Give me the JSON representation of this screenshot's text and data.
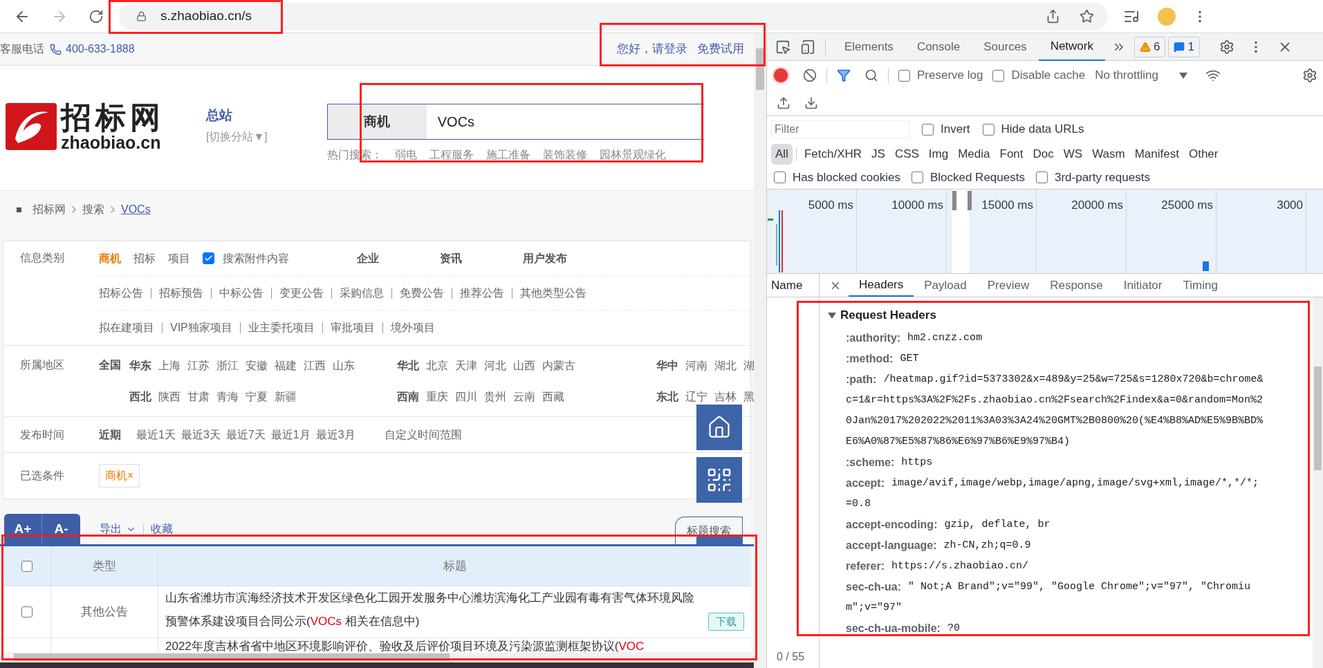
{
  "browser": {
    "url": "s.zhaobiao.cn/s"
  },
  "page": {
    "topbar": {
      "phone_label": "客服电话",
      "phone": "400-633-1888",
      "links": [
        "您好，请登录",
        "免费试用"
      ]
    },
    "logo": {
      "name": "招标网",
      "domain": "zhaobiao.cn"
    },
    "station": {
      "name": "总站",
      "switch": "[切换分站▼]"
    },
    "search": {
      "category": "商机",
      "value": "VOCs",
      "hot_label": "热门搜索：",
      "hot": [
        "弱电",
        "工程服务",
        "施工准备",
        "装饰装修",
        "园林景观绿化"
      ]
    },
    "breadcrumb": [
      "招标网",
      "搜索",
      "VOCs"
    ],
    "filters": [
      {
        "label": "信息类别",
        "kind": "category",
        "lines": [
          {
            "divided": false,
            "items": [
              {
                "kind": "option",
                "text": "商机",
                "selected": true
              },
              {
                "kind": "option",
                "text": "招标",
                "selected": false
              },
              {
                "kind": "option",
                "text": "项目",
                "selected": false
              },
              {
                "kind": "checkbox",
                "text": "搜索附件内容",
                "checked": true
              },
              {
                "kind": "heading",
                "text": "企业"
              },
              {
                "kind": "heading",
                "text": "资讯"
              },
              {
                "kind": "heading",
                "text": "用户发布"
              }
            ]
          },
          {
            "divided": true,
            "items": [
              {
                "kind": "option",
                "text": "招标公告",
                "selected": false
              },
              {
                "kind": "option",
                "text": "招标预告",
                "selected": false
              },
              {
                "kind": "option",
                "text": "中标公告",
                "selected": false
              },
              {
                "kind": "option",
                "text": "变更公告",
                "selected": false
              },
              {
                "kind": "option",
                "text": "采购信息",
                "selected": false
              },
              {
                "kind": "option",
                "text": "免费公告",
                "selected": false
              },
              {
                "kind": "option",
                "text": "推荐公告",
                "selected": false
              },
              {
                "kind": "option",
                "text": "其他类型公告",
                "selected": false
              }
            ]
          },
          {
            "divided": true,
            "items": [
              {
                "kind": "option",
                "text": "拟在建项目",
                "selected": false
              },
              {
                "kind": "option",
                "text": "VIP独家项目",
                "selected": false
              },
              {
                "kind": "option",
                "text": "业主委托项目",
                "selected": false
              },
              {
                "kind": "option",
                "text": "审批项目",
                "selected": false
              },
              {
                "kind": "option",
                "text": "境外项目",
                "selected": false
              }
            ]
          }
        ]
      },
      {
        "label": "所属地区",
        "kind": "region",
        "lead": "全国",
        "lines": [
          [
            {
              "region": "华东",
              "areas": [
                "上海",
                "江苏",
                "浙江",
                "安徽",
                "福建",
                "江西",
                "山东"
              ]
            },
            {
              "region": "华北",
              "areas": [
                "北京",
                "天津",
                "河北",
                "山西",
                "内蒙古"
              ]
            },
            {
              "region": "华中",
              "areas": [
                "河南",
                "湖北",
                "湖"
              ]
            }
          ],
          [
            {
              "region": "西北",
              "areas": [
                "陕西",
                "甘肃",
                "青海",
                "宁夏",
                "新疆"
              ]
            },
            {
              "region": "西南",
              "areas": [
                "重庆",
                "四川",
                "贵州",
                "云南",
                "西藏"
              ]
            },
            {
              "region": "东北",
              "areas": [
                "辽宁",
                "吉林",
                "黑"
              ]
            }
          ]
        ]
      },
      {
        "label": "发布时间",
        "kind": "time",
        "lead": "近期",
        "options": [
          "最近1天",
          "最近3天",
          "最近7天",
          "最近1月",
          "最近3月"
        ],
        "custom": "自定义时间范围"
      },
      {
        "label": "已选条件",
        "kind": "chosen",
        "tags": [
          {
            "text": "商机",
            "remove": "×"
          }
        ]
      }
    ],
    "toolbar": {
      "font_buttons": [
        "A+",
        "A-"
      ],
      "export": "导出",
      "favorite": "收藏",
      "title_search": "标题搜索"
    },
    "table": {
      "header_checked": false,
      "columns": [
        "类型",
        "标题"
      ],
      "rows": [
        {
          "checked": false,
          "type": "其他公告",
          "title": {
            "before": "山东省潍坊市滨海经济技术开发区绿色化工园开发服务中心潍坊滨海化工产业园有毒有害气体环境风险预警体系建设项目合同公示(",
            "highlight": "VOCs",
            "after": " 相关在信息中)"
          },
          "download": "下载"
        },
        {
          "title": {
            "before": "2022年度吉林省省中地区环境影响评价、验收及后评价项目环境及污染源监测框架协议(",
            "highlight": "VOC"
          }
        }
      ]
    }
  },
  "devtools": {
    "tabs": [
      {
        "label": "Elements",
        "selected": false
      },
      {
        "label": "Console",
        "selected": false
      },
      {
        "label": "Sources",
        "selected": false
      },
      {
        "label": "Network",
        "selected": true
      }
    ],
    "warnings": "6",
    "messages": "1",
    "toolbar": {
      "recording": true,
      "checkboxes": [
        {
          "label": "Preserve log",
          "checked": false
        },
        {
          "label": "Disable cache",
          "checked": false
        }
      ],
      "throttling": "No throttling"
    },
    "filter": {
      "placeholder": "Filter",
      "checkboxes": [
        {
          "label": "Invert",
          "checked": false
        },
        {
          "label": "Hide data URLs",
          "checked": false
        }
      ]
    },
    "types": [
      {
        "label": "All",
        "selected": true
      },
      {
        "label": "Fetch/XHR",
        "selected": false
      },
      {
        "label": "JS",
        "selected": false
      },
      {
        "label": "CSS",
        "selected": false
      },
      {
        "label": "Img",
        "selected": false
      },
      {
        "label": "Media",
        "selected": false
      },
      {
        "label": "Font",
        "selected": false
      },
      {
        "label": "Doc",
        "selected": false
      },
      {
        "label": "WS",
        "selected": false
      },
      {
        "label": "Wasm",
        "selected": false
      },
      {
        "label": "Manifest",
        "selected": false
      },
      {
        "label": "Other",
        "selected": false
      }
    ],
    "extra_checkboxes": [
      {
        "label": "Has blocked cookies",
        "checked": false
      },
      {
        "label": "Blocked Requests",
        "checked": false
      },
      {
        "label": "3rd-party requests",
        "checked": false
      }
    ],
    "overview": {
      "ticks": [
        "5000 ms",
        "10000 ms",
        "15000 ms",
        "20000 ms",
        "25000 ms",
        "3000"
      ]
    },
    "detail": {
      "name_header": "Name",
      "tabs": [
        {
          "label": "Headers",
          "selected": true
        },
        {
          "label": "Payload",
          "selected": false
        },
        {
          "label": "Preview",
          "selected": false
        },
        {
          "label": "Response",
          "selected": false
        },
        {
          "label": "Initiator",
          "selected": false
        },
        {
          "label": "Timing",
          "selected": false
        }
      ],
      "section": "Request Headers",
      "expanded": true,
      "headers": [
        {
          "name": ":authority:",
          "lines": [
            "hm2.cnzz.com"
          ]
        },
        {
          "name": ":method:",
          "lines": [
            "GET"
          ]
        },
        {
          "name": ":path:",
          "lines": [
            "/heatmap.gif?id=5373302&x=489&y=25&w=725&s=1280x720&b=chrome&",
            "c=1&r=https%3A%2F%2Fs.zhaobiao.cn%2Fsearch%2Findex&a=0&random=Mon%2",
            "0Jan%2017%202022%2011%3A03%3A24%20GMT%2B0800%20(%E4%B8%AD%E5%9B%BD%",
            "E6%A0%87%E5%87%86%E6%97%B6%E9%97%B4)"
          ]
        },
        {
          "name": ":scheme:",
          "lines": [
            "https"
          ]
        },
        {
          "name": "accept:",
          "lines": [
            "image/avif,image/webp,image/apng,image/svg+xml,image/*,*/*;",
            "=0.8"
          ]
        },
        {
          "name": "accept-encoding:",
          "lines": [
            "gzip, deflate, br"
          ]
        },
        {
          "name": "accept-language:",
          "lines": [
            "zh-CN,zh;q=0.9"
          ]
        },
        {
          "name": "referer:",
          "lines": [
            "https://s.zhaobiao.cn/"
          ]
        },
        {
          "name": "sec-ch-ua:",
          "lines": [
            "\" Not;A Brand\";v=\"99\", \"Google Chrome\";v=\"97\", \"Chromiu",
            "m\";v=\"97\""
          ]
        },
        {
          "name": "sec-ch-ua-mobile:",
          "lines": [
            "?0"
          ]
        }
      ],
      "status": "0 / 55"
    }
  }
}
